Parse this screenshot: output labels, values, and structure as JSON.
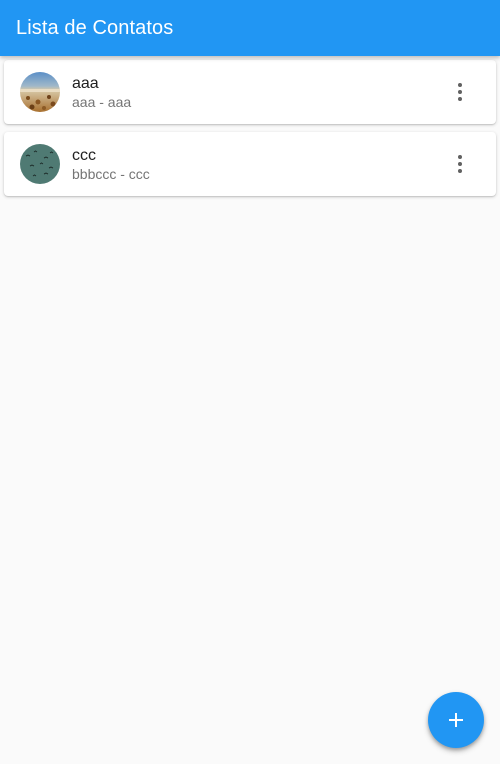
{
  "appbar": {
    "title": "Lista de Contatos",
    "color": "#2196F3"
  },
  "contacts": [
    {
      "name": "aaa",
      "subtitle": "aaa - aaa",
      "avatar_icon": "photo-beach-avatar",
      "menu_icon": "more-vert-icon"
    },
    {
      "name": "ccc",
      "subtitle": "bbbccc - ccc",
      "avatar_icon": "photo-birds-avatar",
      "menu_icon": "more-vert-icon"
    }
  ],
  "fab": {
    "icon": "add-icon",
    "color": "#2196F3"
  }
}
